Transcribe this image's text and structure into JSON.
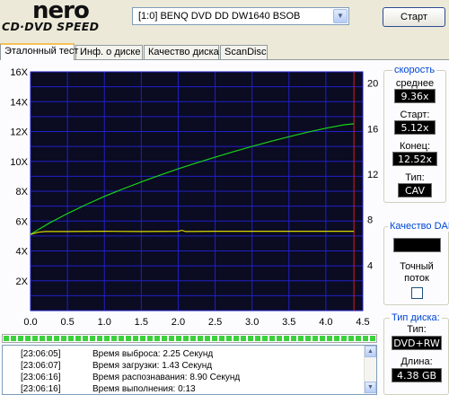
{
  "header": {
    "logo_top": "nero",
    "logo_bottom": "CD·DVD SPEED",
    "drive": "[1:0]   BENQ DVD DD DW1640 BSOB",
    "start_label": "Старт"
  },
  "tabs": [
    {
      "label": "Эталонный тест"
    },
    {
      "label": "Инф. о диске"
    },
    {
      "label": "Качество диска"
    },
    {
      "label": "ScanDisc"
    }
  ],
  "speed": {
    "title": "скорость",
    "avg_label": "среднее",
    "avg_value": "9.36x",
    "start_label": "Старт:",
    "start_value": "5.12x",
    "end_label": "Конец:",
    "end_value": "12.52x",
    "type_label": "Тип:",
    "type_value": "CAV"
  },
  "dae": {
    "title": "Качество DAE",
    "value": "",
    "accurate_line1": "Точный",
    "accurate_line2": "поток"
  },
  "disc": {
    "title": "Тип диска:",
    "type_label": "Тип:",
    "type_value": "DVD+RW",
    "length_label": "Длина:",
    "length_value": "4.38 GB"
  },
  "progress": {
    "value": 1.0
  },
  "log": [
    {
      "time": "[23:06:05]",
      "message": "Время выброса: 2.25 Секунд"
    },
    {
      "time": "[23:06:07]",
      "message": "Время загрузки: 1.43 Секунд"
    },
    {
      "time": "[23:06:16]",
      "message": "Время распознавания: 8.90 Секунд"
    },
    {
      "time": "[23:06:16]",
      "message": "Время выполнения:  0:13"
    }
  ],
  "colors": {
    "plot_bg": "#0b0b22",
    "grid": "#2020c8",
    "read_speed": "#18d418",
    "cpu_line": "#d8d800",
    "marker": "#d02020",
    "label_accent": "#0046d5"
  },
  "chart_data": {
    "type": "line",
    "xlim": [
      0,
      4.5
    ],
    "x_ticks": [
      "0.0",
      "0.5",
      "1.0",
      "1.5",
      "2.0",
      "2.5",
      "3.0",
      "3.5",
      "4.0",
      "4.5"
    ],
    "y_left_lim": [
      0,
      16
    ],
    "y_left_ticks": [
      "16X",
      "14X",
      "12X",
      "10X",
      "8X",
      "6X",
      "4X",
      "2X"
    ],
    "y_right_lim": [
      0,
      21
    ],
    "y_right_ticks": [
      "20",
      "16",
      "12",
      "8",
      "4"
    ],
    "grid": true,
    "marker_x": 4.38,
    "series": [
      {
        "x": [
          0,
          0.25,
          0.5,
          0.75,
          1.0,
          1.25,
          1.5,
          1.75,
          2.0,
          2.25,
          2.5,
          2.75,
          3.0,
          3.25,
          3.5,
          3.75,
          4.0,
          4.25,
          4.38
        ],
        "values": [
          5.12,
          5.85,
          6.5,
          7.1,
          7.65,
          8.15,
          8.62,
          9.07,
          9.5,
          9.9,
          10.28,
          10.65,
          11.0,
          11.33,
          11.65,
          11.95,
          12.22,
          12.45,
          12.52
        ]
      },
      {
        "x": [
          0,
          0.1,
          0.2,
          0.5,
          1.0,
          1.5,
          2.0,
          2.05,
          2.1,
          2.5,
          3.0,
          3.5,
          4.0,
          4.38
        ],
        "values": [
          5.1,
          5.25,
          5.3,
          5.3,
          5.32,
          5.3,
          5.32,
          5.38,
          5.3,
          5.32,
          5.32,
          5.32,
          5.32,
          5.32
        ]
      }
    ]
  }
}
